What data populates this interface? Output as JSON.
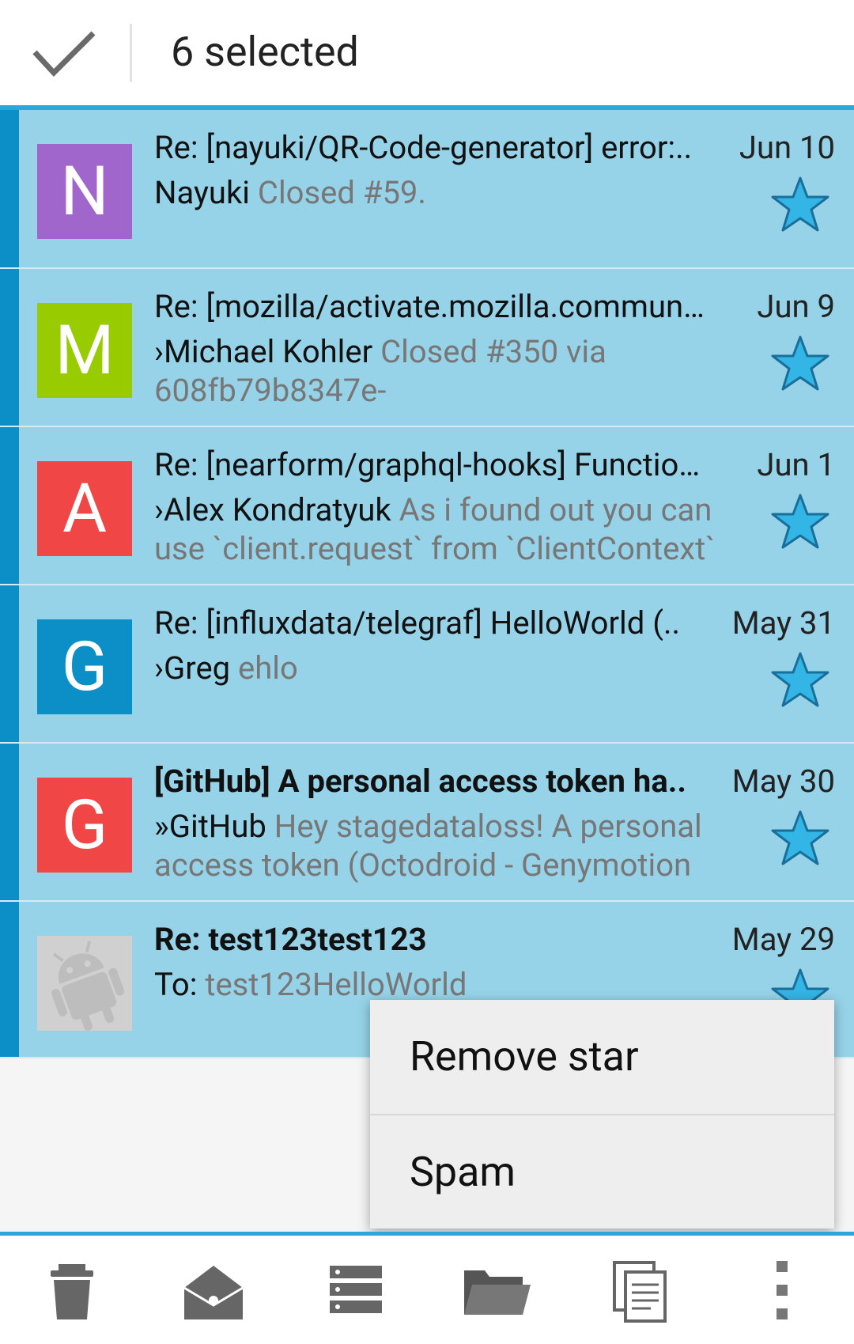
{
  "header": {
    "selection_count_label": "6 selected"
  },
  "messages": [
    {
      "avatar_letter": "N",
      "avatar_color": "#a066cc",
      "subject": "Re: [nayuki/QR-Code-generator] error:..",
      "date": "Jun 10",
      "sender": "Nayuki",
      "preview": " Closed #59.",
      "bold": false
    },
    {
      "avatar_letter": "M",
      "avatar_color": "#99cc00",
      "subject": "Re: [mozilla/activate.mozilla.communit..",
      "date": "Jun 9",
      "sender": "›Michael Kohler",
      "preview": " Closed #350 via 608fb79b8347e-",
      "bold": false
    },
    {
      "avatar_letter": "A",
      "avatar_color": "#f04646",
      "subject": "Re: [nearform/graphql-hooks] Function..",
      "date": "Jun 1",
      "sender": "›Alex Kondratyuk",
      "preview": " As i found out you can use `client.request` from `ClientContext`",
      "bold": false
    },
    {
      "avatar_letter": "G",
      "avatar_color": "#0b8fc6",
      "subject": "Re: [influxdata/telegraf] HelloWorld (..",
      "date": "May 31",
      "sender": "›Greg",
      "preview": " ehlo",
      "bold": false
    },
    {
      "avatar_letter": "G",
      "avatar_color": "#f04646",
      "subject": "[GitHub] A personal access token ha..",
      "date": "May 30",
      "sender": "»GitHub",
      "preview": " Hey stagedataloss! A personal access token (Octodroid - Genymotion",
      "bold": true
    },
    {
      "avatar_letter": "",
      "avatar_color": "#d0d0d0",
      "subject": "Re: test123test123",
      "date": "May 29",
      "sender": "To:",
      "preview": " test123HelloWorld",
      "bold": true
    }
  ],
  "popup_menu": {
    "items": [
      "Remove star",
      "Spam"
    ]
  },
  "toolbar": {
    "icons": [
      "trash-icon",
      "mark-read-icon",
      "archive-icon",
      "move-folder-icon",
      "copy-icon",
      "overflow-menu-icon"
    ]
  },
  "colors": {
    "accent": "#2aa8d8",
    "selection_bar": "#0b8fc6",
    "row_selected": "#96d3e8",
    "star": "#33b5e5"
  }
}
